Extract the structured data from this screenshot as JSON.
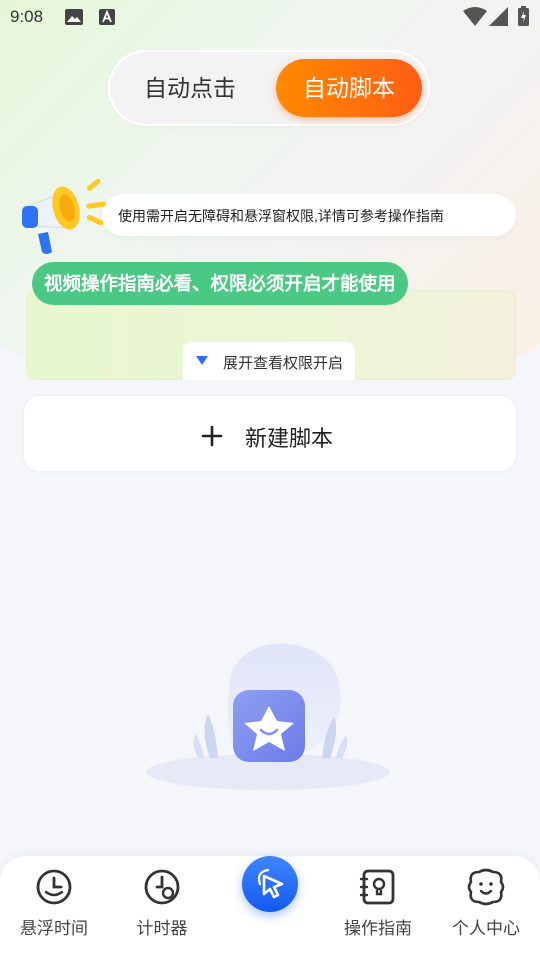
{
  "status_bar": {
    "time": "9:08",
    "icons": [
      "image-icon",
      "text-a-icon",
      "wifi-icon",
      "signal-icon",
      "battery-icon"
    ]
  },
  "mode_toggle": {
    "auto_click_label": "自动点击",
    "auto_script_label": "自动脚本",
    "selected": "自动脚本",
    "accent_color": "#ff6a10"
  },
  "notice": {
    "text": "使用需开启无障碍和悬浮窗权限,详情可参考操作指南"
  },
  "guide_card": {
    "pill_text": "视频操作指南必看、权限必须开启才能使用",
    "expand_label": "展开查看权限开启",
    "pill_color": "#4bc984"
  },
  "new_script": {
    "label": "新建脚本"
  },
  "bottom_nav": {
    "items": [
      {
        "label": "悬浮时间",
        "icon": "clock-smile-icon"
      },
      {
        "label": "计时器",
        "icon": "timer-icon"
      },
      {
        "label": "",
        "icon": "cursor-icon"
      },
      {
        "label": "操作指南",
        "icon": "guide-book-icon"
      },
      {
        "label": "个人中心",
        "icon": "profile-icon"
      }
    ],
    "fab_color": "#1f68f5"
  }
}
